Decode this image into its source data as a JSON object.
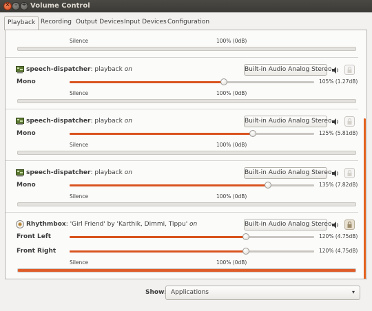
{
  "window": {
    "title": "Volume Control",
    "close_glyph": "×",
    "min_glyph": "–",
    "max_glyph": "+"
  },
  "tabs": [
    {
      "label": "Playback",
      "active": true
    },
    {
      "label": "Recording",
      "active": false
    },
    {
      "label": "Output Devices",
      "active": false
    },
    {
      "label": "Input Devices",
      "active": false
    },
    {
      "label": "Configuration",
      "active": false
    }
  ],
  "top_stream": {
    "silence_label": "Silence",
    "hundred_label": "100% (0dB)",
    "meter_level": 0
  },
  "streams": [
    {
      "app": "speech-dispatcher",
      "sep": ": playback ",
      "state": "on",
      "device": "Built-in Audio Analog Stereo",
      "channels": [
        {
          "label": "Mono",
          "level": 1.05,
          "value": "105% (1.27dB)"
        }
      ],
      "silence_label": "Silence",
      "hundred_label": "100% (0dB)",
      "meter_level": 0,
      "locked": false,
      "icon": "speech-dispatcher-icon"
    },
    {
      "app": "speech-dispatcher",
      "sep": ": playback ",
      "state": "on",
      "device": "Built-in Audio Analog Stereo",
      "channels": [
        {
          "label": "Mono",
          "level": 1.25,
          "value": "125% (5.81dB)"
        }
      ],
      "silence_label": "Silence",
      "hundred_label": "100% (0dB)",
      "meter_level": 0,
      "locked": false,
      "icon": "speech-dispatcher-icon"
    },
    {
      "app": "speech-dispatcher",
      "sep": ": playback ",
      "state": "on",
      "device": "Built-in Audio Analog Stereo",
      "channels": [
        {
          "label": "Mono",
          "level": 1.35,
          "value": "135% (7.82dB)"
        }
      ],
      "silence_label": "Silence",
      "hundred_label": "100% (0dB)",
      "meter_level": 0,
      "locked": false,
      "icon": "speech-dispatcher-icon"
    },
    {
      "app": "Rhythmbox",
      "sep": ": 'Girl Friend' by 'Karthik, Dimmi, Tippu' ",
      "state": "on",
      "device": "Built-in Audio Analog Stereo",
      "channels": [
        {
          "label": "Front Left",
          "level": 1.2,
          "value": "120% (4.75dB)"
        },
        {
          "label": "Front Right",
          "level": 1.2,
          "value": "120% (4.75dB)"
        }
      ],
      "silence_label": "Silence",
      "hundred_label": "100% (0dB)",
      "meter_level": 1.0,
      "locked": true,
      "icon": "rhythmbox-icon"
    }
  ],
  "show": {
    "label": "Show:",
    "value": "Applications",
    "arrow": "▾"
  },
  "colors": {
    "accent": "#d9531e",
    "titlebar": "#3c3b37"
  }
}
